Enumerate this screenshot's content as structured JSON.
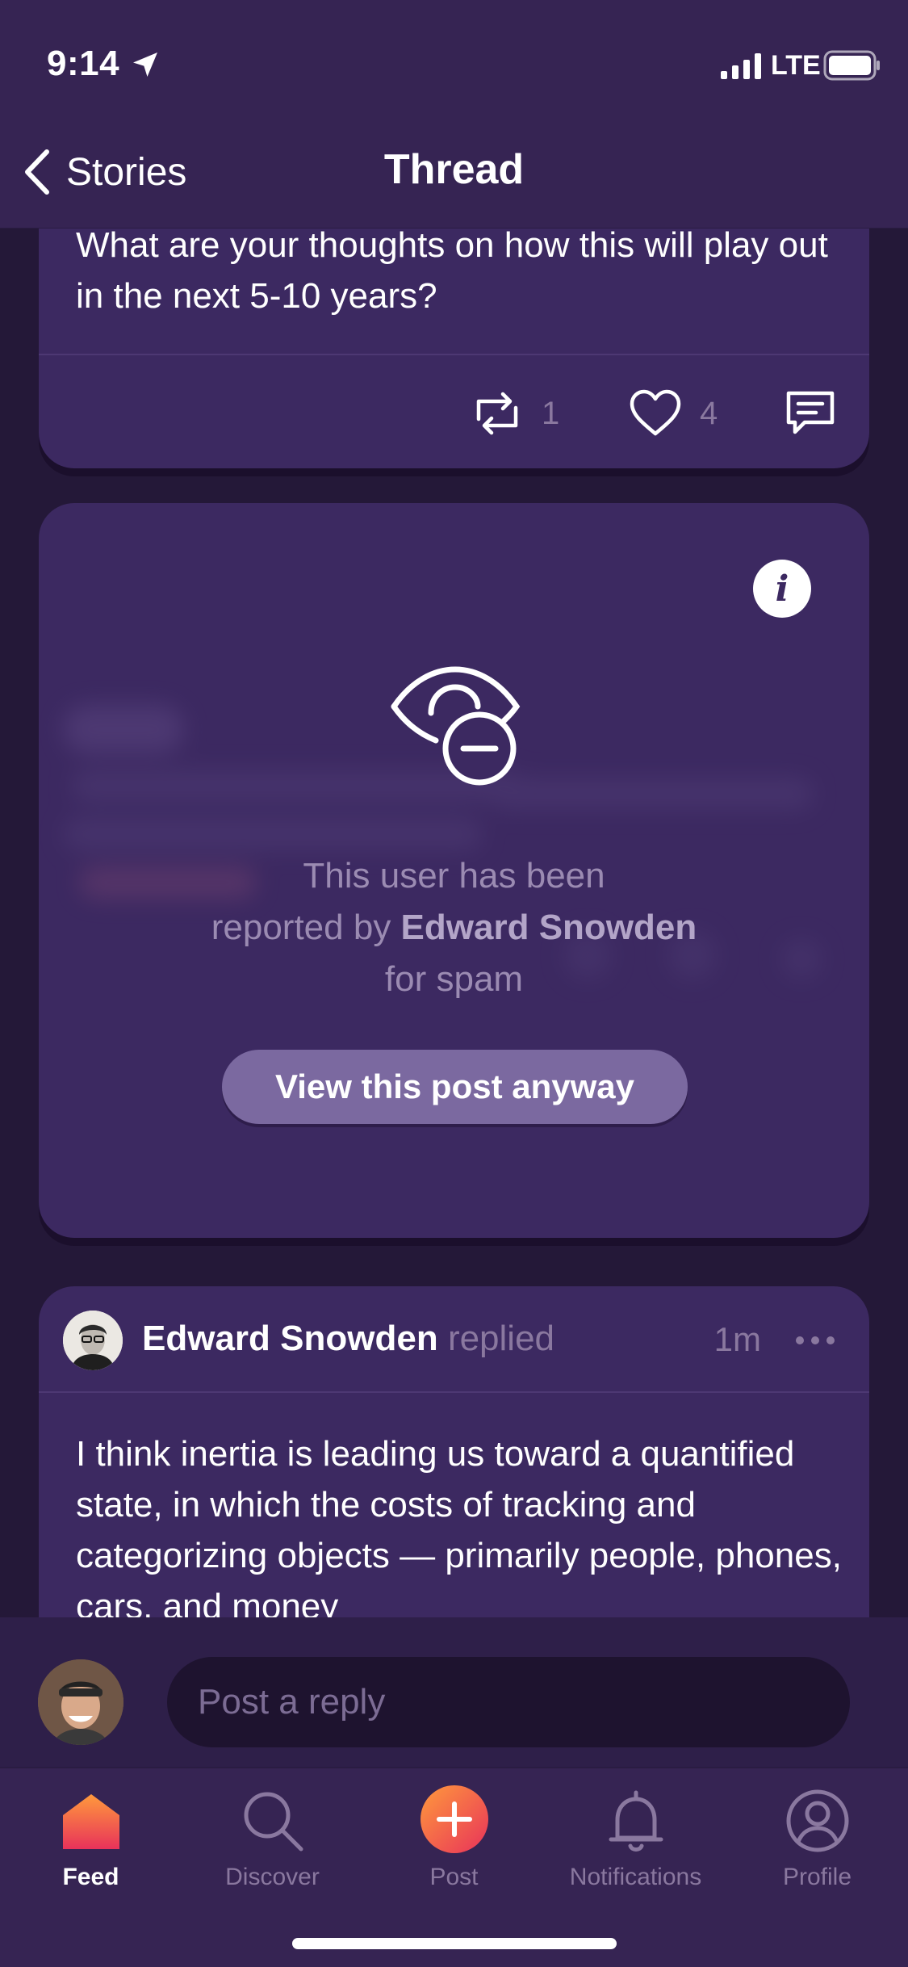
{
  "status_bar": {
    "time": "9:14",
    "network": "LTE"
  },
  "nav": {
    "back_label": "Stories",
    "title": "Thread"
  },
  "post": {
    "text": "What are your thoughts on how this will play out in the next 5-10 years?",
    "repost_count": "1",
    "like_count": "4"
  },
  "hidden_post": {
    "line1": "This user has been",
    "line2_prefix": "reported by ",
    "reporter": "Edward Snowden",
    "line3": "for spam",
    "view_button": "View this post anyway"
  },
  "reply": {
    "author": "Edward Snowden",
    "verb": "replied",
    "time": "1m",
    "text": "I think inertia is leading us toward a quantified state, in which the costs of tracking and categorizing objects — primarily people, phones, cars, and money"
  },
  "compose": {
    "placeholder": "Post a reply"
  },
  "tabs": [
    {
      "label": "Feed",
      "icon": "home-icon"
    },
    {
      "label": "Discover",
      "icon": "search-icon"
    },
    {
      "label": "Post",
      "icon": "plus-icon"
    },
    {
      "label": "Notifications",
      "icon": "bell-icon"
    },
    {
      "label": "Profile",
      "icon": "profile-icon"
    }
  ],
  "colors": {
    "background": "#241838",
    "card": "#3c2961",
    "header": "#362453",
    "muted_text": "#8a789f",
    "accent_gradient_start": "#ff9a3c",
    "accent_gradient_end": "#e8325a"
  }
}
